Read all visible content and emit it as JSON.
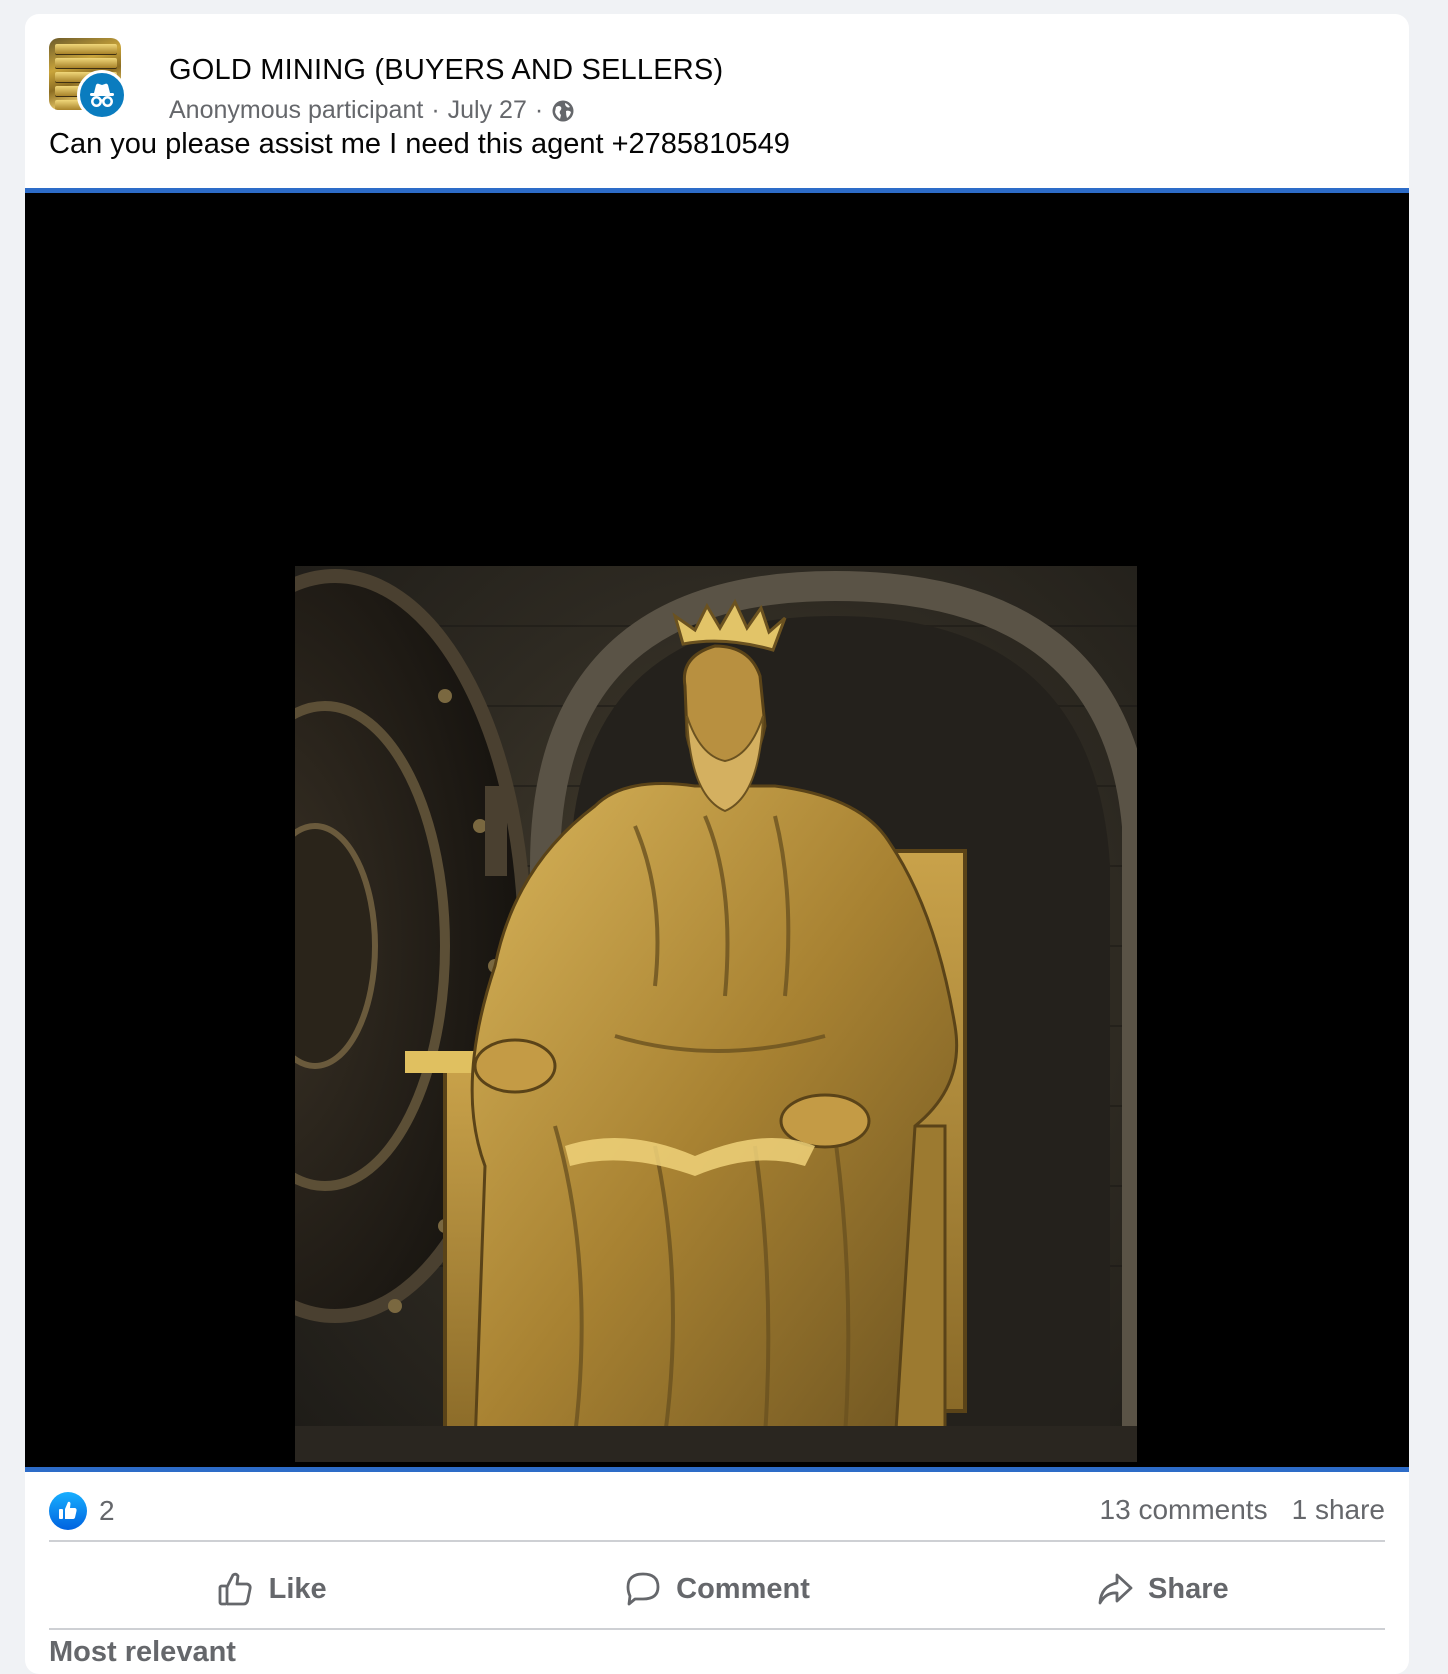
{
  "post": {
    "group_name": "GOLD MINING (BUYERS AND SELLERS)",
    "author": "Anonymous participant",
    "date": "July 27",
    "separator": "·",
    "privacy_icon": "globe-icon",
    "text": "Can you please assist me I need this agent +2785810549",
    "image_icon": "golden-king-statue-image"
  },
  "stats": {
    "reactions": "2",
    "comments": "13 comments",
    "shares": "1 share"
  },
  "actions": {
    "like": "Like",
    "comment": "Comment",
    "share": "Share"
  },
  "comments": {
    "sort_label": "Most relevant"
  },
  "colors": {
    "accent": "#2d6cc8",
    "like_blue": "#0866ff",
    "anonymous_badge": "#0a7cbf",
    "secondary_text": "#65676b"
  }
}
